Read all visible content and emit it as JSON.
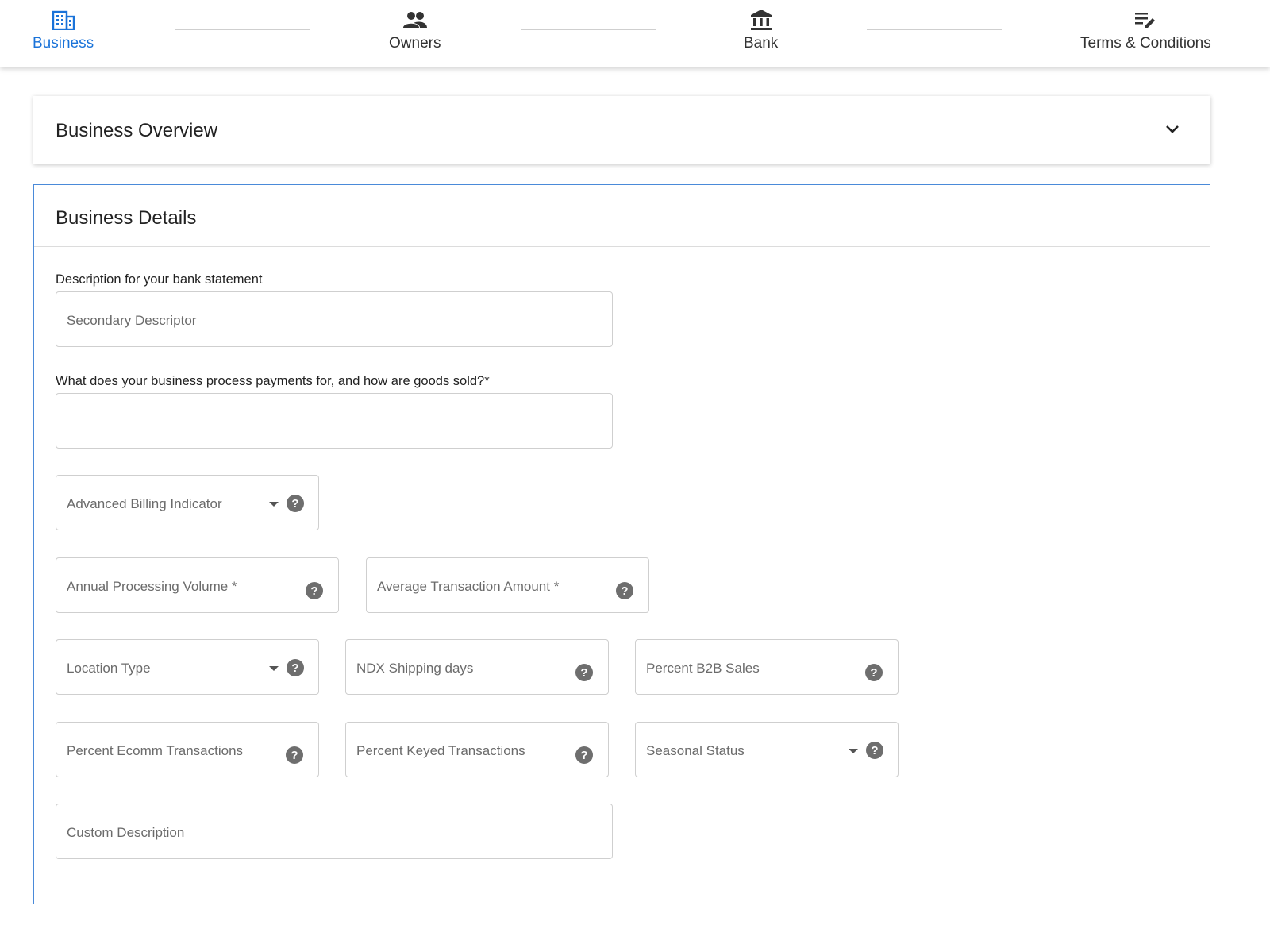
{
  "stepper": {
    "steps": [
      {
        "label": "Business",
        "icon": "business-building-icon",
        "active": true
      },
      {
        "label": "Owners",
        "icon": "people-icon",
        "active": false
      },
      {
        "label": "Bank",
        "icon": "bank-icon",
        "active": false
      },
      {
        "label": "Terms & Conditions",
        "icon": "edit-list-icon",
        "active": false
      }
    ]
  },
  "overview": {
    "title": "Business Overview",
    "icon": "chevron-down-icon"
  },
  "details": {
    "title": "Business Details",
    "bank_statement_label": "Description for your bank statement",
    "secondary_descriptor_placeholder": "Secondary Descriptor",
    "process_payments_label": "What does your business process payments for, and how are goods sold?*",
    "process_payments_value": "",
    "advanced_billing_placeholder": "Advanced Billing Indicator",
    "annual_volume_placeholder": "Annual Processing Volume *",
    "avg_transaction_placeholder": "Average Transaction Amount *",
    "location_type_placeholder": "Location Type",
    "ndx_shipping_placeholder": "NDX Shipping days",
    "percent_b2b_placeholder": "Percent B2B Sales",
    "percent_ecomm_placeholder": "Percent Ecomm Transactions",
    "percent_keyed_placeholder": "Percent Keyed Transactions",
    "seasonal_status_placeholder": "Seasonal Status",
    "custom_description_placeholder": "Custom Description",
    "help_glyph": "?"
  },
  "colors": {
    "accent": "#1a73d9",
    "card_border": "#4a8ad9",
    "help_icon": "#6e6e6e"
  }
}
